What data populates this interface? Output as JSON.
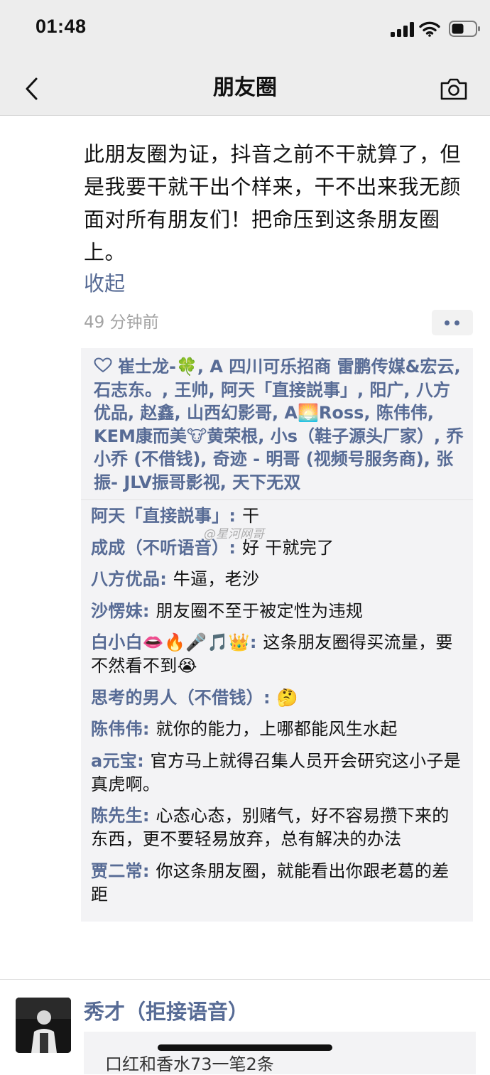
{
  "status_bar": {
    "time": "01:48",
    "icons": [
      "signal-icon",
      "wifi-icon",
      "battery-icon"
    ]
  },
  "nav": {
    "title": "朋友圈",
    "back_icon": "chevron-left-icon",
    "camera_icon": "camera-icon"
  },
  "post": {
    "text": "此朋友圈为证，抖音之前不干就算了，但是我要干就干出个样来，干不出来我无颜面对所有朋友们！把命压到这条朋友圈上。",
    "collapse_label": "收起",
    "time": "49 分钟前"
  },
  "likes": {
    "names": "崔士龙-🍀, A  四川可乐招商 雷鹏传媒&宏云, 石志东。, 王帅, 阿天「直接説事」, 阳广, 八方优品, 赵鑫, 山西幻影哥, A🌅Ross, 陈伟伟, KEM康而美🐮黄荣根, 小s（鞋子源头厂家）, 乔小乔 (不借钱), 奇迹 - 明哥 (视频号服务商), 张振- JLV振哥影视, 天下无双"
  },
  "comments": [
    {
      "author": "阿天「直接説事」",
      "text": "干"
    },
    {
      "author": "成成（不听语音）",
      "text": "好 干就完了"
    },
    {
      "author": "八方优品",
      "text": "牛逼，老沙"
    },
    {
      "author": "沙愣妹",
      "text": "朋友圈不至于被定性为违规"
    },
    {
      "author": "白小白👄🔥🎤🎵👑",
      "text": "这条朋友圈得买流量，要不然看不到😭"
    },
    {
      "author": "思考的男人（不借钱）",
      "text": "🤔"
    },
    {
      "author": "陈伟伟",
      "text": "就你的能力，上哪都能风生水起"
    },
    {
      "author": "a元宝",
      "text": "官方马上就得召集人员开会研究这小子是真虎啊。"
    },
    {
      "author": "陈先生",
      "text": "心态心态，别赌气，好不容易攒下来的东西，更不要轻易放弃，总有解决的办法"
    },
    {
      "author": "贾二常",
      "text": "你这条朋友圈，就能看出你跟老葛的差距"
    }
  ],
  "watermark": "@星河网哥",
  "next_post": {
    "author": "秀才（拒接语音）",
    "preview": "口红和香水73一笔2条"
  },
  "colors": {
    "link": "#576b95",
    "header_bg": "#ededed",
    "comment_bg": "#f3f3f5",
    "meta_text": "#a3a3a3"
  }
}
